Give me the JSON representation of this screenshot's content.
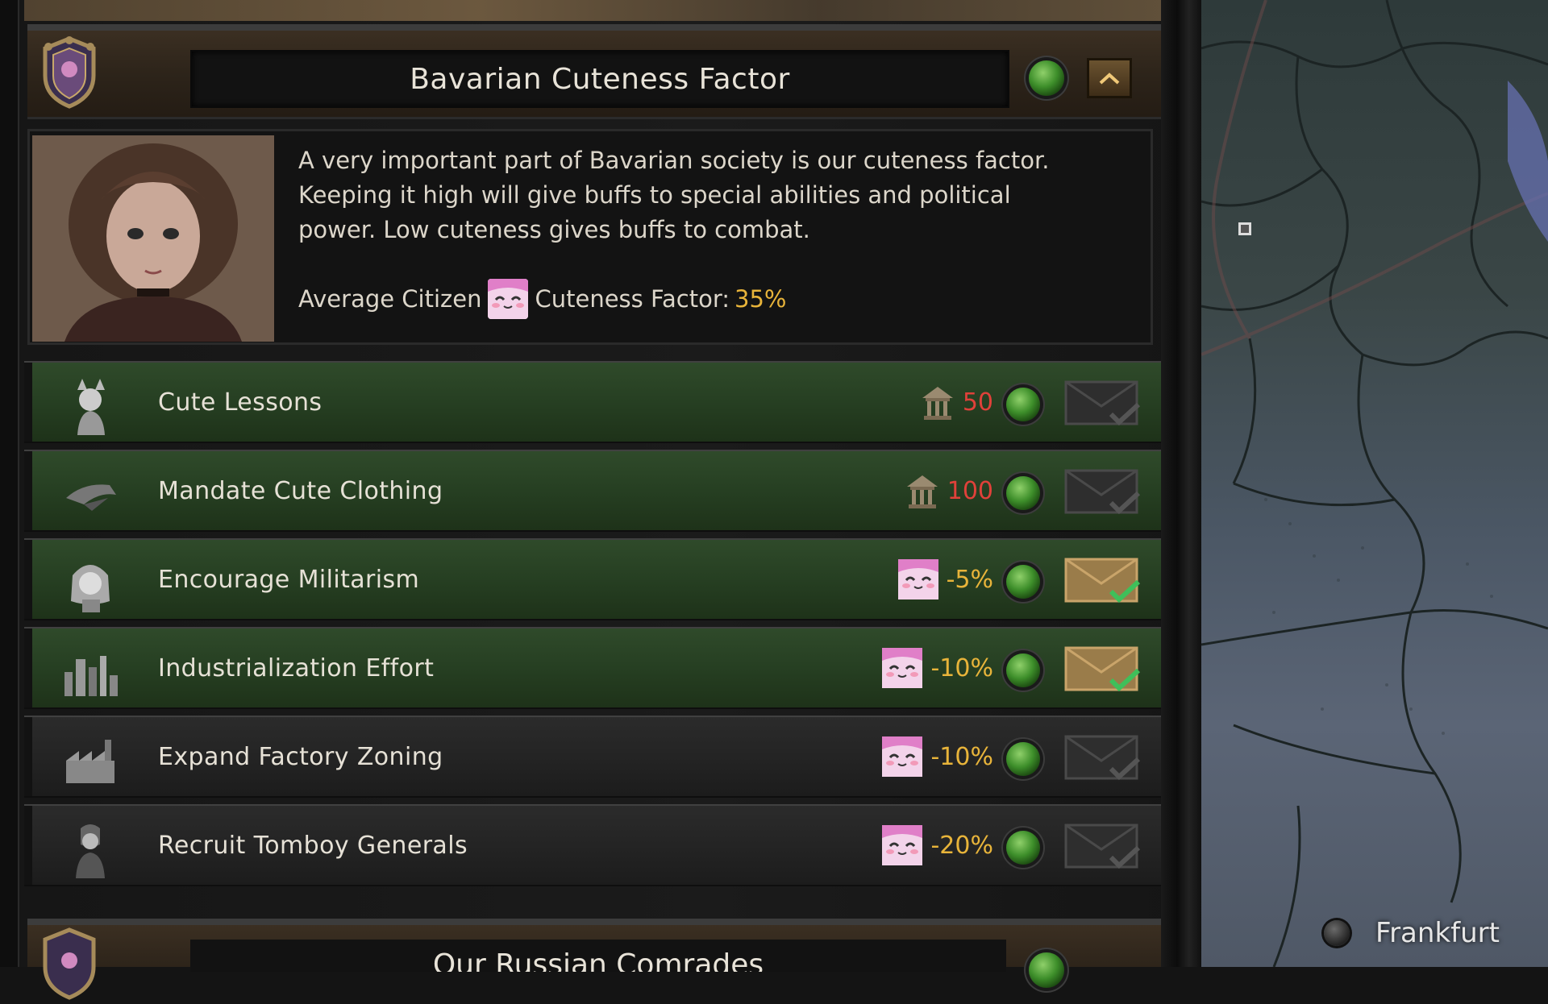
{
  "header": {
    "title": "Bavarian Cuteness Factor",
    "emblem_icon": "bavarian-crest-icon",
    "collapse_icon": "chevron-up-icon"
  },
  "description": {
    "lines": [
      "A very important part of Bavarian society is our cuteness factor.",
      "Keeping it high will give buffs to special abilities and political",
      "power. Low cuteness gives buffs to combat."
    ],
    "avg_prefix": "Average Citizen",
    "avg_suffix": "Cuteness Factor:",
    "avg_value": "35%",
    "cute_icon": "cute-face-icon"
  },
  "decisions": [
    {
      "label": "Cute Lessons",
      "cost_icon": "political-power-icon",
      "cost": "50",
      "cost_color": "#e0413a",
      "row_style": "green",
      "icon": "cat-girl-icon",
      "mail_state": "disabled"
    },
    {
      "label": "Mandate Cute Clothing",
      "cost_icon": "political-power-icon",
      "cost": "100",
      "cost_color": "#e0413a",
      "row_style": "green",
      "icon": "hat-icon",
      "mail_state": "disabled"
    },
    {
      "label": "Encourage Militarism",
      "cost_icon": "cute-face-icon",
      "cost": "-5%",
      "cost_color": "#e8b43a",
      "row_style": "green",
      "icon": "soldier-girl-icon",
      "mail_state": "enabled"
    },
    {
      "label": "Industrialization Effort",
      "cost_icon": "cute-face-icon",
      "cost": "-10%",
      "cost_color": "#e8b43a",
      "row_style": "green",
      "icon": "city-skyline-icon",
      "mail_state": "enabled"
    },
    {
      "label": "Expand Factory Zoning",
      "cost_icon": "cute-face-icon",
      "cost": "-10%",
      "cost_color": "#e8b43a",
      "row_style": "dark",
      "icon": "factory-icon",
      "mail_state": "disabled"
    },
    {
      "label": "Recruit Tomboy Generals",
      "cost_icon": "cute-face-icon",
      "cost": "-20%",
      "cost_color": "#e8b43a",
      "row_style": "dark",
      "icon": "general-icon",
      "mail_state": "disabled"
    }
  ],
  "next_category": {
    "title": "Our Russian Comrades"
  },
  "map": {
    "city_label": "Frankfurt"
  },
  "colors": {
    "cost_red": "#e0413a",
    "cost_yellow": "#e8b43a",
    "row_green": "#2b4526",
    "row_dark": "#262626",
    "status_green": "#3d8e2a"
  }
}
